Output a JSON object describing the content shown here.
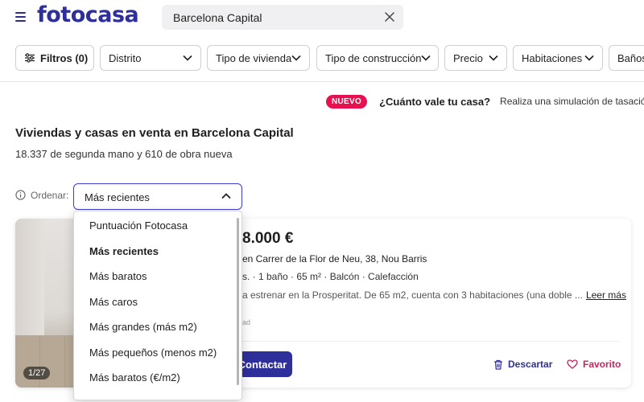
{
  "header": {
    "logo": "fotocasa",
    "search_value": "Barcelona Capital"
  },
  "filters": {
    "filtros_label": "Filtros (0)",
    "chips": [
      "Distrito",
      "Tipo de vivienda",
      "Tipo de construcción",
      "Precio",
      "Habitaciones",
      "Baños"
    ]
  },
  "valuation": {
    "badge": "NUEVO",
    "question": "¿Cuánto vale tu casa?",
    "description": "Realiza una simulación de tasación o"
  },
  "listing_header": {
    "title": "Viviendas y casas en venta en Barcelona Capital",
    "subtitle": "18.337 de segunda mano y 610 de obra nueva"
  },
  "sort": {
    "label": "Ordenar:",
    "selected": "Más recientes",
    "options": [
      "Puntuación Fotocasa",
      "Más recientes",
      "Más baratos",
      "Más caros",
      "Más grandes (más m2)",
      "Más pequeños (menos m2)",
      "Más baratos (€/m2)"
    ]
  },
  "listing": {
    "price": "8.000 €",
    "address": "en Carrer de la Flor de Neu, 38, Nou Barris",
    "features": "s. · 1 baño · 65 m² · Balcón · Calefacción",
    "description": "a estrenar en la Prosperitat. De 65 m2, cuenta con 3 habitaciones (una doble ...",
    "read_more": "Leer más",
    "agency": "ad",
    "photo_counter": "1/27",
    "contact_label": "Contactar",
    "discard_label": "Descartar",
    "favorite_label": "Favorito"
  },
  "colors": {
    "brand": "#2f2f9c",
    "accent_select": "#3d3bd8",
    "badge": "#e8104f",
    "favorite": "#c7245c"
  }
}
